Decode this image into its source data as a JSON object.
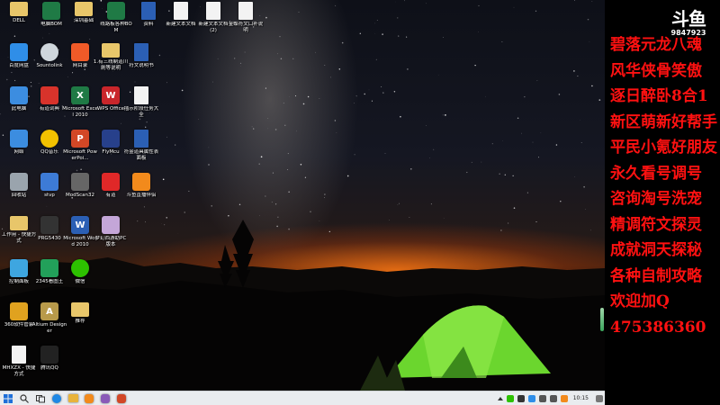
{
  "desktop": {
    "icons": [
      {
        "label": "DELL",
        "glyph": "folder",
        "color": "#e8c66a"
      },
      {
        "label": "电脑BOM",
        "glyph": "xls",
        "color": "#1f7a45"
      },
      {
        "label": "深圳基础",
        "glyph": "folder",
        "color": "#e8c66a"
      },
      {
        "label": "线路板各种BOM",
        "glyph": "xls",
        "color": "#1f7a45"
      },
      {
        "label": "资料",
        "glyph": "doc",
        "color": "#2b5fb4"
      },
      {
        "label": "新建文本文档",
        "glyph": "txt",
        "color": "#f3f3f3"
      },
      {
        "label": "新建文本文档(2)",
        "glyph": "txt",
        "color": "#f3f3f3"
      },
      {
        "label": "金蝶符文口补说明",
        "glyph": "txt",
        "color": "#f3f3f3"
      },
      {
        "label": "百度网盘",
        "glyph": "cloud",
        "color": "#2f8ee8"
      },
      {
        "label": "Sountolink",
        "glyph": "disc",
        "color": "#cfd6dc"
      },
      {
        "label": "网目录",
        "glyph": "app",
        "color": "#f05a28"
      },
      {
        "label": "1.有三线制道川刷等说明",
        "glyph": "folder",
        "color": "#e8c66a"
      },
      {
        "label": "符文说明书",
        "glyph": "doc",
        "color": "#2b5fb4"
      },
      {
        "label": "此电脑",
        "glyph": "pc",
        "color": "#3c8de0"
      },
      {
        "label": "有道词典",
        "glyph": "book",
        "color": "#d8332b"
      },
      {
        "label": "Microsoft Excel 2010",
        "glyph": "X",
        "color": "#1f7a45"
      },
      {
        "label": "WPS Office",
        "glyph": "W",
        "color": "#c9262b"
      },
      {
        "label": "插示阶段任务大全",
        "glyph": "txt",
        "color": "#f3f3f3"
      },
      {
        "label": "网络",
        "glyph": "net",
        "color": "#3c8de0"
      },
      {
        "label": "QQ音乐",
        "glyph": "music",
        "color": "#f2c100"
      },
      {
        "label": "Microsoft PowerPoi...",
        "glyph": "P",
        "color": "#d24726"
      },
      {
        "label": "FlyMcu",
        "glyph": "fly",
        "color": "#27408b"
      },
      {
        "label": "符金道具属性表面板",
        "glyph": "doc",
        "color": "#2b5fb4"
      },
      {
        "label": "回收站",
        "glyph": "bin",
        "color": "#9aa4ad"
      },
      {
        "label": "stvp",
        "glyph": "tool",
        "color": "#3d7bd6"
      },
      {
        "label": "ModScan32",
        "glyph": "scan",
        "color": "#666666"
      },
      {
        "label": "有道",
        "glyph": "app",
        "color": "#e02828"
      },
      {
        "label": "斗鱼直播伴侣",
        "glyph": "fish",
        "color": "#f28a1c"
      },
      {
        "label": "工作用 - 快捷方式",
        "glyph": "folder",
        "color": "#e8c66a"
      },
      {
        "label": "PRG5430",
        "glyph": "chip",
        "color": "#333333"
      },
      {
        "label": "Microsoft Word 2010",
        "glyph": "W",
        "color": "#2b5fb4"
      },
      {
        "label": "梦幻西游助PC版本",
        "glyph": "game",
        "color": "#c4a6d8"
      },
      {
        "label": "控制面板",
        "glyph": "panel",
        "color": "#3ea6e0"
      },
      {
        "label": "2345看图王",
        "glyph": "img",
        "color": "#22a05a"
      },
      {
        "label": "微信",
        "glyph": "chat",
        "color": "#2dc100"
      },
      {
        "label": "360软件管家",
        "glyph": "grid",
        "color": "#e0a21f"
      },
      {
        "label": "Altium Designer",
        "glyph": "A",
        "color": "#b89a4a"
      },
      {
        "label": "推荐",
        "glyph": "folder",
        "color": "#e8c66a"
      },
      {
        "label": "MHXZX - 快捷方式",
        "glyph": "txt",
        "color": "#f3f3f3"
      },
      {
        "label": "腾讯QQ",
        "glyph": "qq",
        "color": "#222222"
      }
    ]
  },
  "taskbar": {
    "clock": "10:15"
  },
  "overlay": {
    "logo_main": "斗鱼",
    "logo_sub": "9847923",
    "ad_lines": [
      "碧落元龙八魂",
      "风华侠骨笑傲",
      "逐日醉卧8合1",
      "新区萌新好帮手",
      "平民小氪好朋友",
      "永久看号调号",
      "咨询淘号洗宠",
      "精调符文探灵",
      "成就洞天探秘",
      "各种自制攻略",
      "欢迎加Q",
      "475386360"
    ]
  }
}
